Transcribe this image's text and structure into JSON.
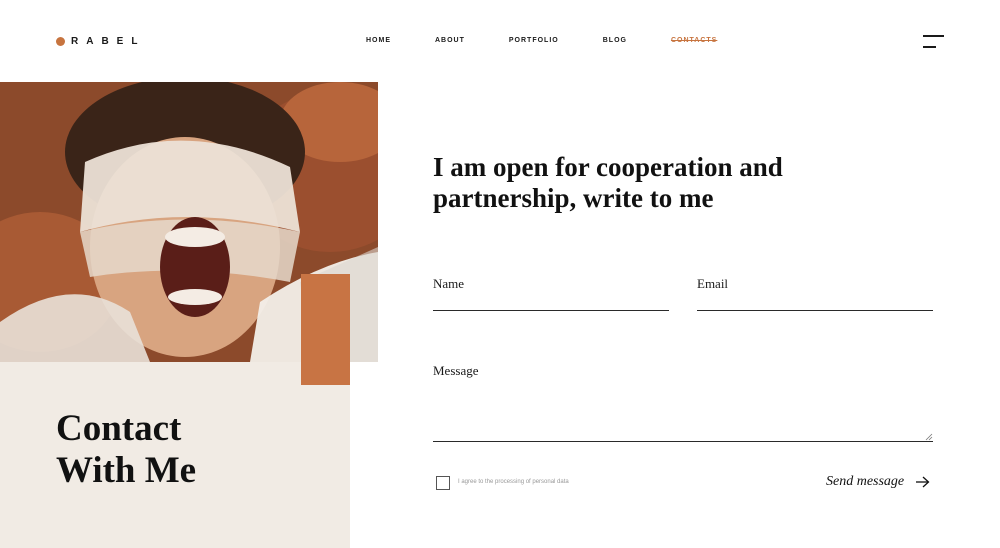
{
  "header": {
    "logo_text": "RABEL",
    "nav": [
      "HOME",
      "ABOUT",
      "PORTFOLIO",
      "BLOG",
      "CONTACTS"
    ],
    "active_nav": "CONTACTS"
  },
  "hero": {
    "contact_title_line1": "Contact",
    "contact_title_line2": "With Me"
  },
  "form": {
    "heading": "I am open for cooperation and partnership, write to me",
    "name_label": "Name",
    "email_label": "Email",
    "message_label": "Message",
    "consent_text": "I agree to the processing of personal data",
    "send_label": "Send message"
  },
  "colors": {
    "accent": "#c7743f",
    "panel_bg": "#f1ebe4"
  },
  "icons": [
    "logo-dot-icon",
    "menu-icon",
    "arrow-right-icon",
    "resize-handle-icon"
  ]
}
